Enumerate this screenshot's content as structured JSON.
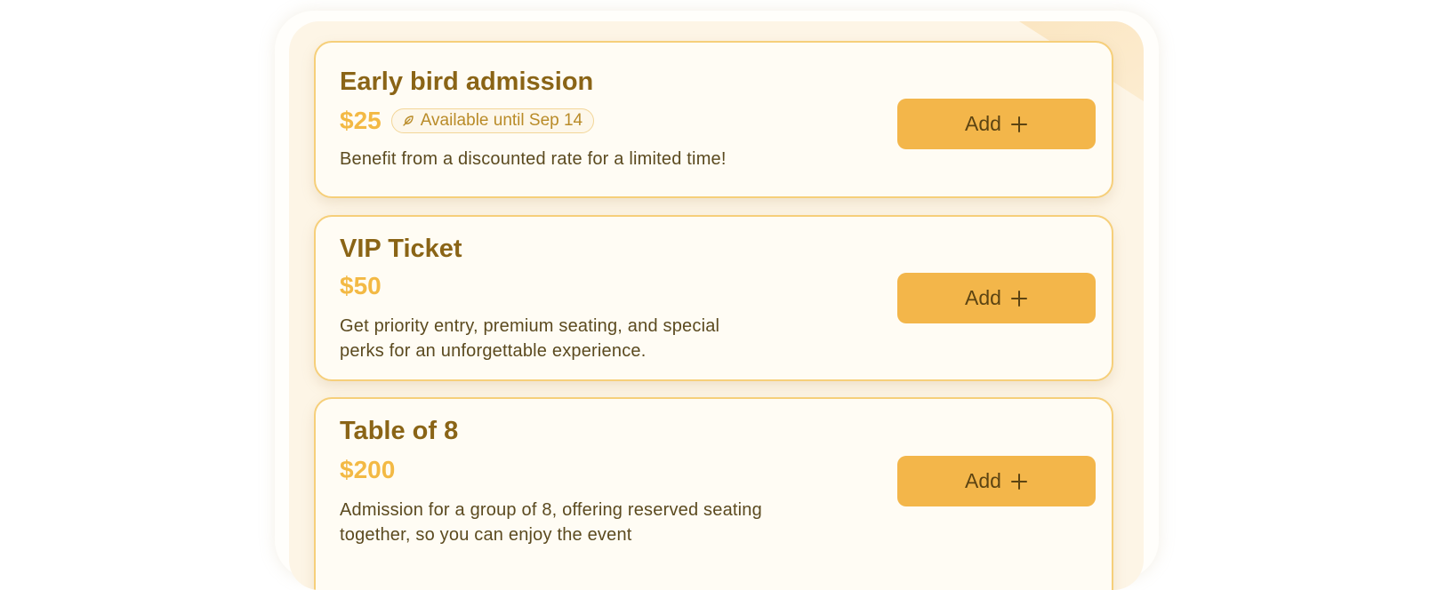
{
  "tickets": [
    {
      "title": "Early bird admission",
      "price": "$25",
      "badge": "Available until Sep 14",
      "badge_icon": "feather-icon",
      "description": "Benefit from a discounted rate for a limited time!",
      "button_label": "Add",
      "button_icon": "plus-icon"
    },
    {
      "title": "VIP Ticket",
      "price": "$50",
      "description": "Get priority entry, premium seating, and special perks for an unforgettable experience.",
      "button_label": "Add",
      "button_icon": "plus-icon"
    },
    {
      "title": "Table of 8",
      "price": "$200",
      "description": "Admission for a group of 8, offering reserved seating together, so you can enjoy the event",
      "button_label": "Add",
      "button_icon": "plus-icon"
    }
  ],
  "colors": {
    "accent": "#f3b64a",
    "title": "#8a6416",
    "price": "#f3b944",
    "card_border": "#f6cf7a",
    "panel_background": "#fdf5e6"
  }
}
